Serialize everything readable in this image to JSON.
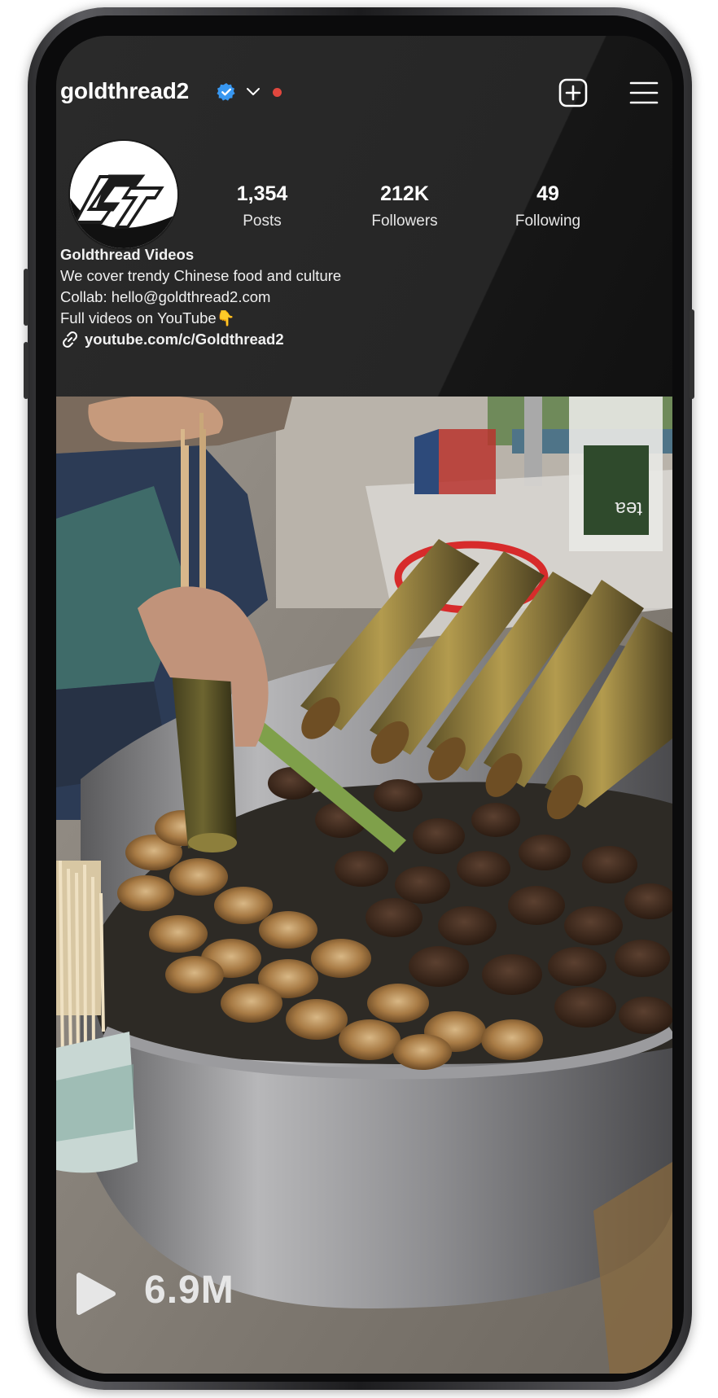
{
  "profile": {
    "username": "goldthread2",
    "stats": [
      {
        "value": "1,354",
        "label": "Posts"
      },
      {
        "value": "212K",
        "label": "Followers"
      },
      {
        "value": "49",
        "label": "Following"
      }
    ],
    "bio": {
      "name": "Goldthread Videos",
      "lines": [
        "We cover trendy Chinese food and culture",
        "Collab: hello@goldthread2.com",
        "Full videos on YouTube👇"
      ],
      "link": "youtube.com/c/Goldthread2"
    },
    "avatar_text": "Gt"
  },
  "video": {
    "views": "6.9M",
    "cup_label": "tea"
  },
  "icons": {
    "verified": "verified-badge-icon",
    "chevron": "chevron-down-icon",
    "new_post": "plus-square-icon",
    "menu": "hamburger-menu-icon",
    "link": "link-icon",
    "play": "play-icon"
  },
  "colors": {
    "verified": "#3897f0",
    "live_dot": "#e0473e",
    "background": "#262626"
  }
}
